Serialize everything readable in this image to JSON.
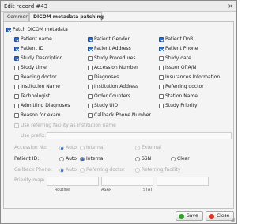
{
  "window": {
    "title": "Edit record #43",
    "close_glyph": "×"
  },
  "tabs": [
    {
      "label": "Common",
      "active": false
    },
    {
      "label": "DICOM metadata patching",
      "active": true
    }
  ],
  "patch": {
    "label": "Patch DICOM metadata",
    "checked": true
  },
  "fields": [
    {
      "label": "Patient name",
      "checked": true
    },
    {
      "label": "Patient Gender",
      "checked": true
    },
    {
      "label": "Patient DoB",
      "checked": true
    },
    {
      "label": "Patient ID",
      "checked": true
    },
    {
      "label": "Patient Address",
      "checked": true
    },
    {
      "label": "Patient Phone",
      "checked": true
    },
    {
      "label": "Study Description",
      "checked": true
    },
    {
      "label": "Study Procedures",
      "checked": false
    },
    {
      "label": "Study date",
      "checked": false
    },
    {
      "label": "Study time",
      "checked": false
    },
    {
      "label": "Accession Number",
      "checked": false
    },
    {
      "label": "Issuer Of A/N",
      "checked": false
    },
    {
      "label": "Reading doctor",
      "checked": false
    },
    {
      "label": "Diagnoses",
      "checked": false
    },
    {
      "label": "Insurances Information",
      "checked": false
    },
    {
      "label": "Institution Name",
      "checked": false
    },
    {
      "label": "Institution Address",
      "checked": false
    },
    {
      "label": "Referring doctor",
      "checked": false
    },
    {
      "label": "Technologist",
      "checked": false
    },
    {
      "label": "Order Counters",
      "checked": false
    },
    {
      "label": "Station Name",
      "checked": false
    },
    {
      "label": "Admitting Diagnoses",
      "checked": false
    },
    {
      "label": "Study UID",
      "checked": false
    },
    {
      "label": "Study Priority",
      "checked": false
    },
    {
      "label": "Reason for exam",
      "checked": false
    },
    {
      "label": "Callback Phone Number",
      "checked": false
    }
  ],
  "use_referring": {
    "label": "Use referring facility as institution name"
  },
  "use_prefix": {
    "label": "Use prefix:",
    "value": ""
  },
  "accession": {
    "label": "Accession No:",
    "options": [
      "Auto",
      "Internal",
      "External"
    ],
    "selected": 0
  },
  "patient_id": {
    "label": "Patient ID:",
    "options": [
      "Auto",
      "Internal",
      "SSN",
      "Clear"
    ],
    "selected": 1
  },
  "callback": {
    "label": "Callback Phone:",
    "options": [
      "Auto",
      "Referring doctor",
      "Referring facility"
    ],
    "selected": 0
  },
  "priority": {
    "label": "Priority map:",
    "columns": [
      "Routine",
      "ASAP",
      "STAT"
    ],
    "values": [
      "",
      "",
      ""
    ]
  },
  "buttons": {
    "save": "Save",
    "close": "Close"
  },
  "colors": {
    "save_icon": "#3a9a2f",
    "close_icon": "#d23b2b",
    "check_fill": "#2d6cc6"
  }
}
